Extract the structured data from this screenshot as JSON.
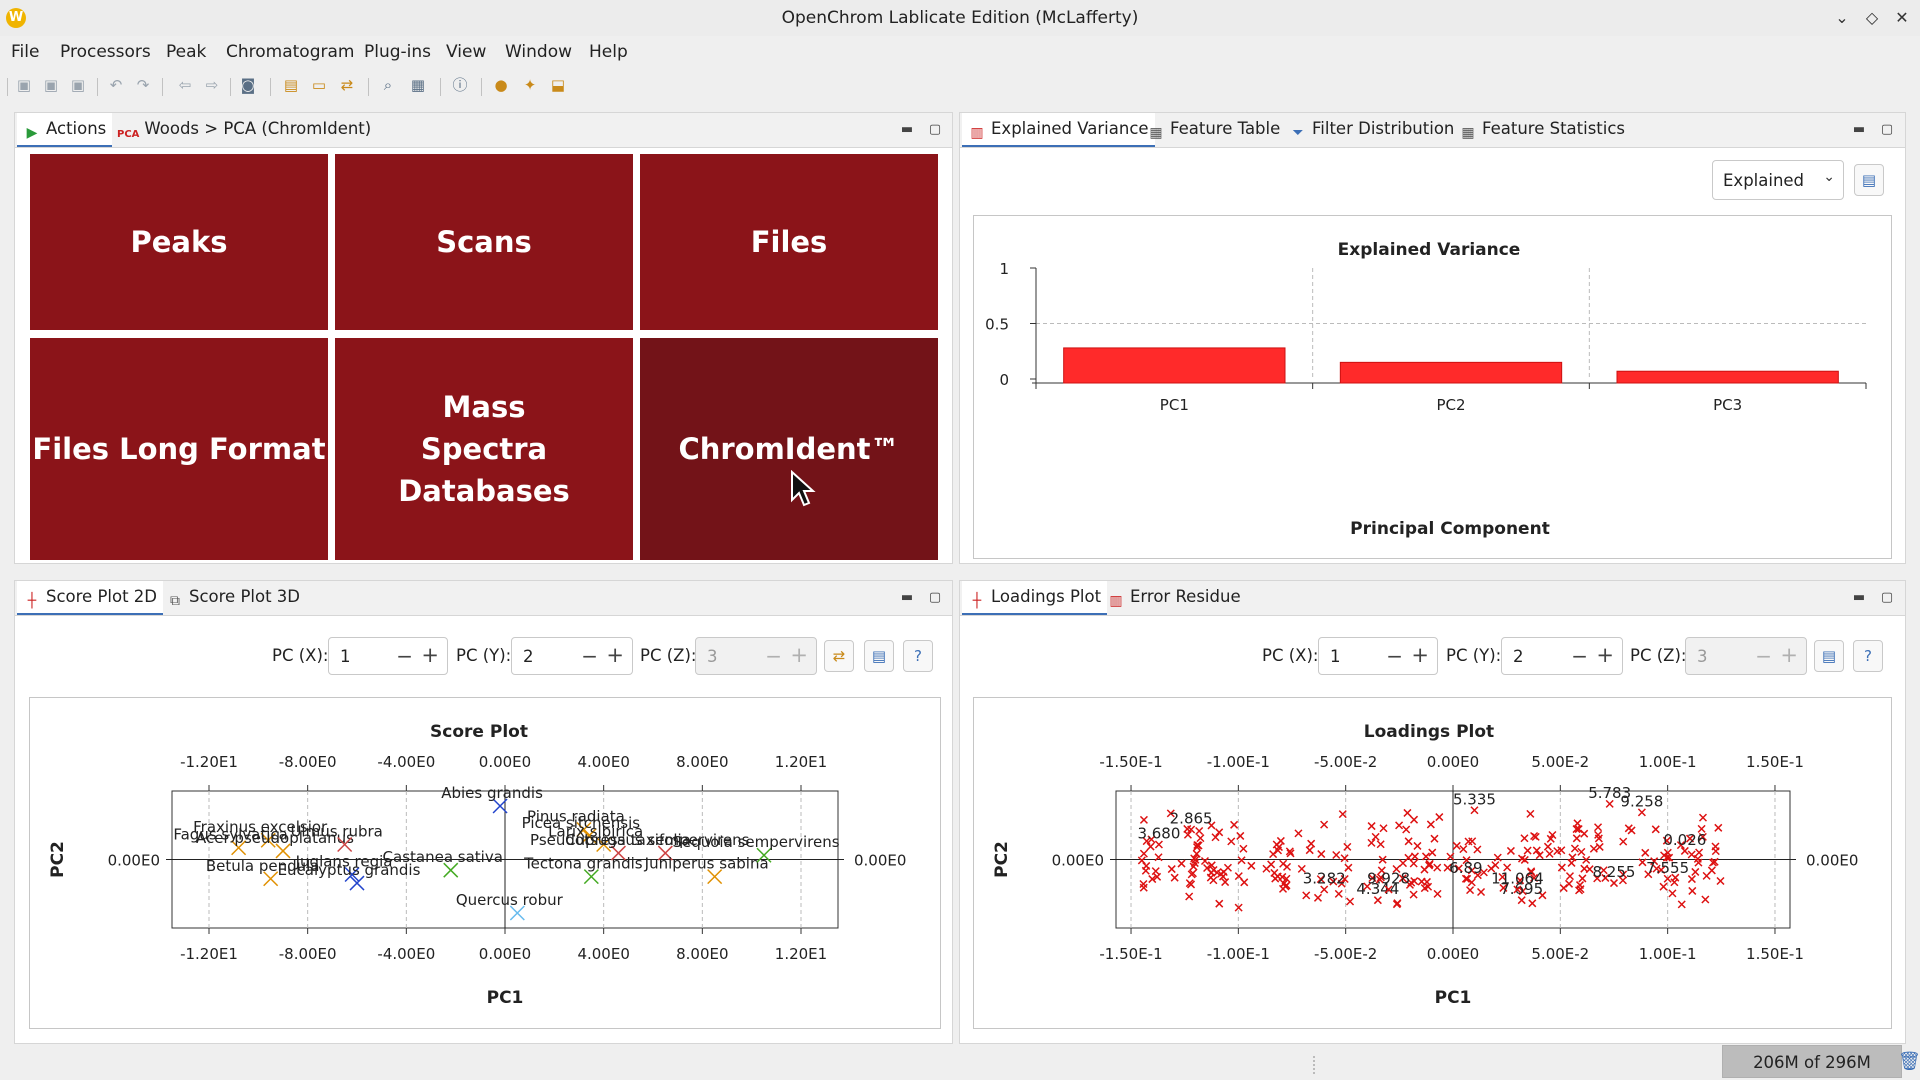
{
  "window": {
    "title": "OpenChrom Lablicate Edition (McLafferty)"
  },
  "menu": [
    "File",
    "Processors",
    "Peak",
    "Chromatogram",
    "Plug-ins",
    "View",
    "Window",
    "Help"
  ],
  "top_left": {
    "tabs": [
      {
        "label": "Actions",
        "icon": "play-icon"
      },
      {
        "label": "Woods > PCA (ChromIdent)",
        "icon": "pca-icon",
        "icon_text": "PCA"
      }
    ],
    "tiles": [
      "Peaks",
      "Scans",
      "Files",
      "Files Long Format",
      "Mass Spectra Databases",
      "ChromIdent™"
    ]
  },
  "top_right": {
    "tabs": [
      "Explained Variance",
      "Feature Table",
      "Filter Distribution",
      "Feature Statistics"
    ],
    "combo_value": "Explained",
    "chart_data": {
      "type": "bar",
      "title": "Explained Variance",
      "xlabel": "Principal Component",
      "ylabel": "",
      "categories": [
        "PC1",
        "PC2",
        "PC3"
      ],
      "values": [
        0.28,
        0.15,
        0.07
      ],
      "ylim": [
        0,
        1
      ],
      "yticks": [
        "1",
        "0.5",
        "0"
      ],
      "bar_color": "#ff2a2a",
      "grid": true
    }
  },
  "bottom_left": {
    "tabs": [
      "Score Plot 2D",
      "Score Plot 3D"
    ],
    "controls": {
      "pcx_label": "PC (X):",
      "pcx": "1",
      "pcy_label": "PC (Y):",
      "pcy": "2",
      "pcz_label": "PC (Z):",
      "pcz": "3"
    },
    "chart_data": {
      "type": "scatter",
      "title": "Score Plot",
      "xlabel": "PC1",
      "ylabel": "PC2",
      "xlim": [
        -13.5,
        13.5
      ],
      "ylim": [
        -3.2,
        3.2
      ],
      "xticks": [
        "-1.20E1",
        "-8.00E0",
        "-4.00E0",
        "0.00E0",
        "4.00E0",
        "8.00E0",
        "1.20E1"
      ],
      "xtick_values": [
        -12,
        -8,
        -4,
        0,
        4,
        8,
        12
      ],
      "ytick": "0.00E0",
      "points": [
        {
          "label": "Abies grandis",
          "x": -0.2,
          "y": 2.5,
          "color": "#2244cc"
        },
        {
          "label": "Fraxinus excelsior",
          "x": -9.6,
          "y": 0.9,
          "color": "#e09000"
        },
        {
          "label": "Fagus sylvatica",
          "x": -10.8,
          "y": 0.55,
          "color": "#e09000"
        },
        {
          "label": "Acer pseudoplatanus",
          "x": -9.0,
          "y": 0.4,
          "color": "#e09000"
        },
        {
          "label": "Ulmus rubra",
          "x": -6.5,
          "y": 0.7,
          "color": "#cc4444"
        },
        {
          "label": "Betula pendula",
          "x": -9.5,
          "y": -0.9,
          "color": "#e09000"
        },
        {
          "label": "Juglans regia",
          "x": -6.2,
          "y": -0.7,
          "color": "#2244cc"
        },
        {
          "label": "Eucalyptus grandis",
          "x": -6.0,
          "y": -1.1,
          "color": "#2244cc"
        },
        {
          "label": "Castanea sativa",
          "x": -2.2,
          "y": -0.5,
          "color": "#44aa22"
        },
        {
          "label": "Quercus robur",
          "x": 0.5,
          "y": -2.5,
          "color": "#66bbee"
        },
        {
          "label": "Pinus radiata",
          "x": 3.2,
          "y": 1.4,
          "color": "#e09000"
        },
        {
          "label": "Picea sitchensis",
          "x": 3.4,
          "y": 1.1,
          "color": "#e09000"
        },
        {
          "label": "Larix sibirica",
          "x": 4.0,
          "y": 0.7,
          "color": "#e09000"
        },
        {
          "label": "Pseudotsuga taxifolia",
          "x": 4.6,
          "y": 0.3,
          "color": "#cc4444"
        },
        {
          "label": "Cupressus sempervirens",
          "x": 6.5,
          "y": 0.3,
          "color": "#cc4444"
        },
        {
          "label": "Tectona grandis",
          "x": 3.5,
          "y": -0.8,
          "color": "#44aa22"
        },
        {
          "label": "Juniperus sabina",
          "x": 8.5,
          "y": -0.8,
          "color": "#e09000"
        },
        {
          "label": "Sequoia sempervirens",
          "x": 10.5,
          "y": 0.2,
          "color": "#44aa22"
        }
      ]
    }
  },
  "bottom_right": {
    "tabs": [
      "Loadings Plot",
      "Error Residue"
    ],
    "controls": {
      "pcx_label": "PC (X):",
      "pcx": "1",
      "pcy_label": "PC (Y):",
      "pcy": "2",
      "pcz_label": "PC (Z):",
      "pcz": "3"
    },
    "chart_data": {
      "type": "scatter",
      "title": "Loadings Plot",
      "xlabel": "PC1",
      "ylabel": "PC2",
      "xlim": [
        -0.157,
        0.157
      ],
      "ylim": [
        -3.2,
        3.2
      ],
      "xticks": [
        "-1.50E-1",
        "-1.00E-1",
        "-5.00E-2",
        "0.00E0",
        "5.00E-2",
        "1.00E-1",
        "1.50E-1"
      ],
      "xtick_values": [
        -0.15,
        -0.1,
        -0.05,
        0,
        0.05,
        0.1,
        0.15
      ],
      "ytick": "0.00E0",
      "marker_color": "#dd1111",
      "labels": [
        {
          "label": "5.783",
          "x": 0.073,
          "y": 2.6
        },
        {
          "label": "5.335",
          "x": 0.01,
          "y": 2.3
        },
        {
          "label": "3.282",
          "x": -0.06,
          "y": -1.4
        },
        {
          "label": "4.344",
          "x": -0.035,
          "y": -1.9
        },
        {
          "label": "7.695",
          "x": 0.032,
          "y": -1.9
        },
        {
          "label": "11.064",
          "x": 0.03,
          "y": -1.4
        },
        {
          "label": "7.555",
          "x": 0.1,
          "y": -0.9
        },
        {
          "label": "2.865",
          "x": -0.122,
          "y": 1.4
        },
        {
          "label": "3.680",
          "x": -0.137,
          "y": 0.7
        },
        {
          "label": "6.89",
          "x": 0.006,
          "y": -0.9
        },
        {
          "label": "9.928",
          "x": -0.03,
          "y": -1.4
        },
        {
          "label": "0.026",
          "x": 0.108,
          "y": 0.4
        },
        {
          "label": "8.255",
          "x": 0.075,
          "y": -1.1
        },
        {
          "label": "9.258",
          "x": 0.088,
          "y": 2.2
        }
      ]
    }
  },
  "status": {
    "memory": "206M of 296M"
  }
}
